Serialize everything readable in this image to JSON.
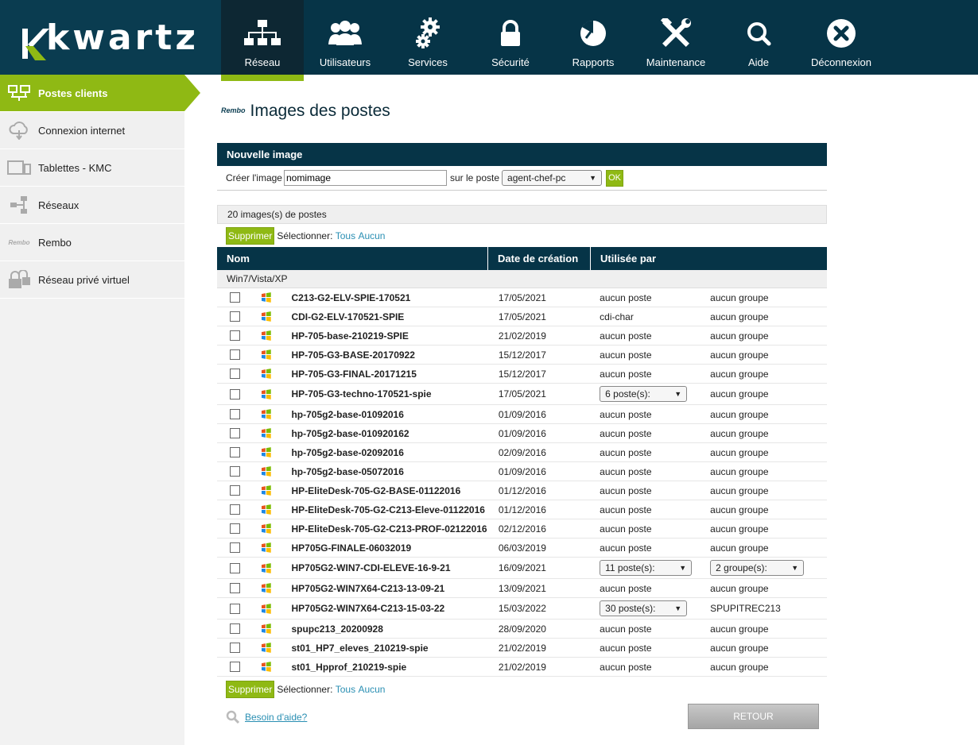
{
  "brand": {
    "logo_text": "kwartz"
  },
  "nav": [
    {
      "label": "Réseau",
      "icon": "network-icon",
      "active": true
    },
    {
      "label": "Utilisateurs",
      "icon": "users-icon"
    },
    {
      "label": "Services",
      "icon": "gears-icon"
    },
    {
      "label": "Sécurité",
      "icon": "lock-icon"
    },
    {
      "label": "Rapports",
      "icon": "pie-chart-icon"
    },
    {
      "label": "Maintenance",
      "icon": "tools-icon"
    },
    {
      "label": "Aide",
      "icon": "search-icon"
    },
    {
      "label": "Déconnexion",
      "icon": "close-circle-icon"
    }
  ],
  "sidebar": [
    {
      "label": "Postes clients",
      "icon": "computers-icon",
      "active": true
    },
    {
      "label": "Connexion internet",
      "icon": "cloud-icon"
    },
    {
      "label": "Tablettes - KMC",
      "icon": "tablet-icon"
    },
    {
      "label": "Réseaux",
      "icon": "network-tree-icon"
    },
    {
      "label": "Rembo",
      "icon": "rembo-icon",
      "icon_text": "Rembo"
    },
    {
      "label": "Réseau privé virtuel",
      "icon": "vpn-lock-icon"
    }
  ],
  "page": {
    "rembo_tag": "Rembo",
    "title": "Images des postes"
  },
  "new_image": {
    "header": "Nouvelle image",
    "create_label": "Créer l'image",
    "name_value": "nomimage",
    "on_label": "sur le poste",
    "poste_selected": "agent-chef-pc",
    "ok_label": "OK"
  },
  "count_text": "20 images(s) de postes",
  "actions": {
    "delete_label": "Supprimer",
    "select_label": "Sélectionner:",
    "all_label": "Tous",
    "none_label": "Aucun"
  },
  "table": {
    "headers": [
      "Nom",
      "Date de création",
      "Utilisée par"
    ],
    "group_label": "Win7/Vista/XP",
    "rows": [
      {
        "name": "C213-G2-ELV-SPIE-170521",
        "date": "17/05/2021",
        "used": "aucun poste",
        "group": "aucun groupe"
      },
      {
        "name": "CDI-G2-ELV-170521-SPIE",
        "date": "17/05/2021",
        "used": "cdi-char",
        "group": "aucun groupe"
      },
      {
        "name": "HP-705-base-210219-SPIE",
        "date": "21/02/2019",
        "used": "aucun poste",
        "group": "aucun groupe"
      },
      {
        "name": "HP-705-G3-BASE-20170922",
        "date": "15/12/2017",
        "used": "aucun poste",
        "group": "aucun groupe"
      },
      {
        "name": "HP-705-G3-FINAL-20171215",
        "date": "15/12/2017",
        "used": "aucun poste",
        "group": "aucun groupe"
      },
      {
        "name": "HP-705-G3-techno-170521-spie",
        "date": "17/05/2021",
        "used": "6 poste(s):",
        "used_select": true,
        "group": "aucun groupe"
      },
      {
        "name": "hp-705g2-base-01092016",
        "date": "01/09/2016",
        "used": "aucun poste",
        "group": "aucun groupe"
      },
      {
        "name": "hp-705g2-base-010920162",
        "date": "01/09/2016",
        "used": "aucun poste",
        "group": "aucun groupe"
      },
      {
        "name": "hp-705g2-base-02092016",
        "date": "02/09/2016",
        "used": "aucun poste",
        "group": "aucun groupe"
      },
      {
        "name": "hp-705g2-base-05072016",
        "date": "01/09/2016",
        "used": "aucun poste",
        "group": "aucun groupe"
      },
      {
        "name": "HP-EliteDesk-705-G2-BASE-01122016",
        "date": "01/12/2016",
        "used": "aucun poste",
        "group": "aucun groupe"
      },
      {
        "name": "HP-EliteDesk-705-G2-C213-Eleve-01122016",
        "date": "01/12/2016",
        "used": "aucun poste",
        "group": "aucun groupe"
      },
      {
        "name": "HP-EliteDesk-705-G2-C213-PROF-02122016",
        "date": "02/12/2016",
        "used": "aucun poste",
        "group": "aucun groupe"
      },
      {
        "name": "HP705G-FINALE-06032019",
        "date": "06/03/2019",
        "used": "aucun poste",
        "group": "aucun groupe"
      },
      {
        "name": "HP705G2-WIN7-CDI-ELEVE-16-9-21",
        "date": "16/09/2021",
        "used": "11 poste(s):",
        "used_select": true,
        "group": "2 groupe(s):",
        "group_select": true
      },
      {
        "name": "HP705G2-WIN7X64-C213-13-09-21",
        "date": "13/09/2021",
        "used": "aucun poste",
        "group": "aucun groupe"
      },
      {
        "name": "HP705G2-WIN7X64-C213-15-03-22",
        "date": "15/03/2022",
        "used": "30 poste(s):",
        "used_select": true,
        "group": "SPUPITREC213"
      },
      {
        "name": "spupc213_20200928",
        "date": "28/09/2020",
        "used": "aucun poste",
        "group": "aucun groupe"
      },
      {
        "name": "st01_HP7_eleves_210219-spie",
        "date": "21/02/2019",
        "used": "aucun poste",
        "group": "aucun groupe"
      },
      {
        "name": "st01_Hpprof_210219-spie",
        "date": "21/02/2019",
        "used": "aucun poste",
        "group": "aucun groupe"
      }
    ]
  },
  "help_label": "Besoin d'aide?",
  "retour_label": "RETOUR",
  "colors": {
    "header_bg": "#063447",
    "accent_green": "#8fb914",
    "link": "#2a8fb3"
  }
}
